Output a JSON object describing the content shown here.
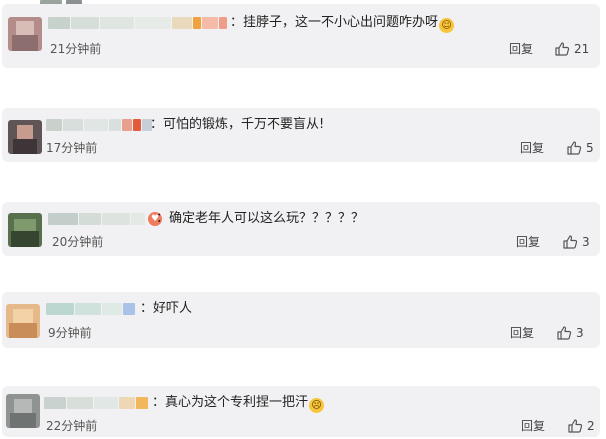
{
  "comments": [
    {
      "separator": "：",
      "text": "挂脖子，这一不小心出问题咋办呀",
      "emoji_name": "sweat-smile-emoji",
      "time": "21分钟前",
      "reply_label": "回复",
      "like_count": "21"
    },
    {
      "separator": "：",
      "text": "可怕的锻炼，千万不要盲从!",
      "time": "17分钟前",
      "reply_label": "回复",
      "like_count": "5"
    },
    {
      "separator": "：",
      "text": "确定老年人可以这么玩？？？？？",
      "time": "20分钟前",
      "reply_label": "回复",
      "like_count": "3"
    },
    {
      "separator": "：",
      "text": "好吓人",
      "time": "9分钟前",
      "reply_label": "回复",
      "like_count": "3"
    },
    {
      "separator": "：",
      "text": "真心为这个专利捏一把汗",
      "emoji_name": "sweat-emoji",
      "time": "22分钟前",
      "reply_label": "回复",
      "like_count": "2"
    }
  ],
  "colors": {
    "card_bg": "#f1f1f3",
    "text": "#222222",
    "meta": "#555555",
    "emoji_yellow": "#f8c43a"
  },
  "icons": {
    "like": "thumbs-up-outline-icon"
  }
}
